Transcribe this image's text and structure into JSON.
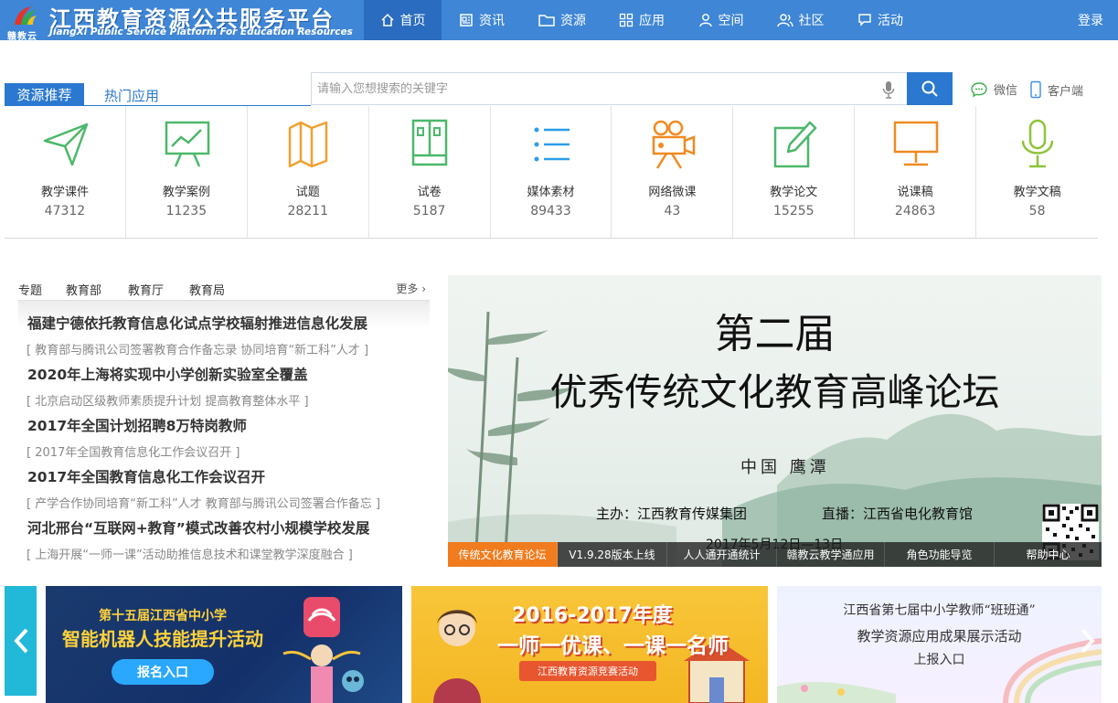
{
  "header": {
    "logo_sub": "赣教云",
    "logo_title": "江西教育资源公共服务平台",
    "logo_en": "JiangXi Public Service Platform For Education Resources",
    "nav": [
      {
        "label": "首页",
        "icon": "home-icon"
      },
      {
        "label": "资讯",
        "icon": "news-icon"
      },
      {
        "label": "资源",
        "icon": "folder-icon"
      },
      {
        "label": "应用",
        "icon": "apps-grid-icon"
      },
      {
        "label": "空间",
        "icon": "user-icon"
      },
      {
        "label": "社区",
        "icon": "community-icon"
      },
      {
        "label": "活动",
        "icon": "flag-icon"
      }
    ],
    "login": "登录"
  },
  "tabs": {
    "primary": "资源推荐",
    "secondary": "热门应用"
  },
  "search": {
    "placeholder": "请输入您想搜索的关键字",
    "value": ""
  },
  "links": {
    "wechat": "微信",
    "client": "客户端"
  },
  "categories": [
    {
      "label": "教学课件",
      "count": "47312",
      "icon": "paper-plane-icon",
      "color": "#4cb86a"
    },
    {
      "label": "教学案例",
      "count": "11235",
      "icon": "chart-board-icon",
      "color": "#4cb86a"
    },
    {
      "label": "试题",
      "count": "28211",
      "icon": "map-icon",
      "color": "#f0a030"
    },
    {
      "label": "试卷",
      "count": "5187",
      "icon": "document-icon",
      "color": "#4cb86a"
    },
    {
      "label": "媒体素材",
      "count": "89433",
      "icon": "list-icon",
      "color": "#2a9ee8"
    },
    {
      "label": "网络微课",
      "count": "43",
      "icon": "projector-icon",
      "color": "#f08a20"
    },
    {
      "label": "教学论文",
      "count": "15255",
      "icon": "pen-paper-icon",
      "color": "#4cb86a"
    },
    {
      "label": "说课稿",
      "count": "24863",
      "icon": "monitor-icon",
      "color": "#f08a20"
    },
    {
      "label": "教学文稿",
      "count": "58",
      "icon": "microphone-icon",
      "color": "#8cc43a"
    }
  ],
  "news": {
    "tabs": [
      "专题",
      "教育部",
      "教育厅",
      "教育局"
    ],
    "active_tab": "教育部",
    "more": "更多",
    "items": [
      {
        "title": "福建宁德依托教育信息化试点学校辐射推进信息化发展",
        "sub": "[ 教育部与腾讯公司签署教育合作备忘录 协同培育“新工科”人才 ]"
      },
      {
        "title": "2020年上海将实现中小学创新实验室全覆盖",
        "sub": "[ 北京启动区级教师素质提升计划 提高教育整体水平 ]"
      },
      {
        "title": "2017年全国计划招聘8万特岗教师",
        "sub": "[ 2017年全国教育信息化工作会议召开 ]"
      },
      {
        "title": "2017年全国教育信息化工作会议召开",
        "sub": "[ 产学合作协同培育“新工科”人才 教育部与腾讯公司签署合作备忘 ]"
      },
      {
        "title": "河北邢台“互联网+教育”模式改善农村小规模学校发展",
        "sub": "[ 上海开展“一师一课”活动助推信息技术和课堂教学深度融合 ]"
      }
    ]
  },
  "banner": {
    "title1": "第二届",
    "title2": "优秀传统文化教育高峰论坛",
    "place": "中国 鹰潭",
    "host": "主办：江西教育传媒集团",
    "live": "直播：江西省电化教育馆",
    "date": "2017年5月12日—13日",
    "tabs": [
      {
        "label": "传统文化教育论坛",
        "active": true
      },
      {
        "label": "V1.9.28版本上线",
        "active": false
      },
      {
        "label": "人人通开通统计",
        "active": false
      },
      {
        "label": "赣教云教学通应用",
        "active": false
      },
      {
        "label": "角色功能导览",
        "active": false
      },
      {
        "label": "帮助中心",
        "active": false
      }
    ]
  },
  "promos": {
    "p1": {
      "line1": "第十五届江西省中小学",
      "line2": "智能机器人技能提升活动",
      "button": "报名入口"
    },
    "p2": {
      "line1": "2016-2017年度",
      "line2": "一师一优课、一课一名师",
      "ribbon": "江西教育资源竞赛活动"
    },
    "p3": {
      "line1": "江西省第七届中小学教师“班班通”",
      "line2": "教学资源应用成果展示活动",
      "line3": "上报入口"
    }
  }
}
